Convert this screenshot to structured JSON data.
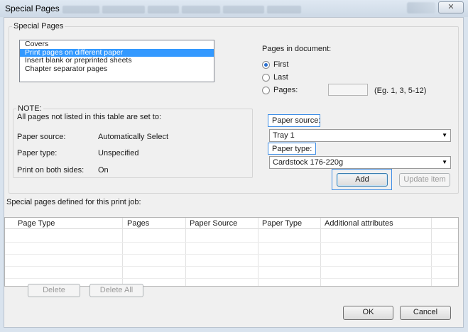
{
  "window": {
    "title": "Special Pages",
    "close_glyph": "✕"
  },
  "special_pages_group": {
    "label": "Special Pages",
    "list_items": [
      "Covers",
      "Print pages on different paper",
      "Insert blank or preprinted sheets",
      "Chapter separator pages"
    ],
    "selected_index": 1
  },
  "pages_in_document": {
    "label": "Pages in document:",
    "options": [
      {
        "label": "First",
        "checked": true
      },
      {
        "label": "Last",
        "checked": false
      },
      {
        "label": "Pages:",
        "checked": false
      }
    ],
    "pages_value": "",
    "pages_hint": "(Eg. 1, 3, 5-12)"
  },
  "note": {
    "label": "NOTE:",
    "text": "All pages not listed in this table are set to:",
    "rows": [
      {
        "key": "Paper source:",
        "value": "Automatically Select"
      },
      {
        "key": "Paper type:",
        "value": "Unspecified"
      },
      {
        "key": "Print on both sides:",
        "value": "On"
      }
    ]
  },
  "paper_source": {
    "label": "Paper source:",
    "value": "Tray 1"
  },
  "paper_type": {
    "label": "Paper type:",
    "value": "Cardstock 176-220g"
  },
  "buttons": {
    "add": "Add",
    "update_item": "Update item",
    "delete": "Delete",
    "delete_all": "Delete All",
    "ok": "OK",
    "cancel": "Cancel"
  },
  "table": {
    "label": "Special pages defined for this print job:",
    "columns": [
      "Page Type",
      "Pages",
      "Paper Source",
      "Paper Type",
      "Additional attributes"
    ],
    "rows": []
  },
  "colors": {
    "selection": "#3399ff",
    "focus_highlight": "#3f8ee6"
  }
}
